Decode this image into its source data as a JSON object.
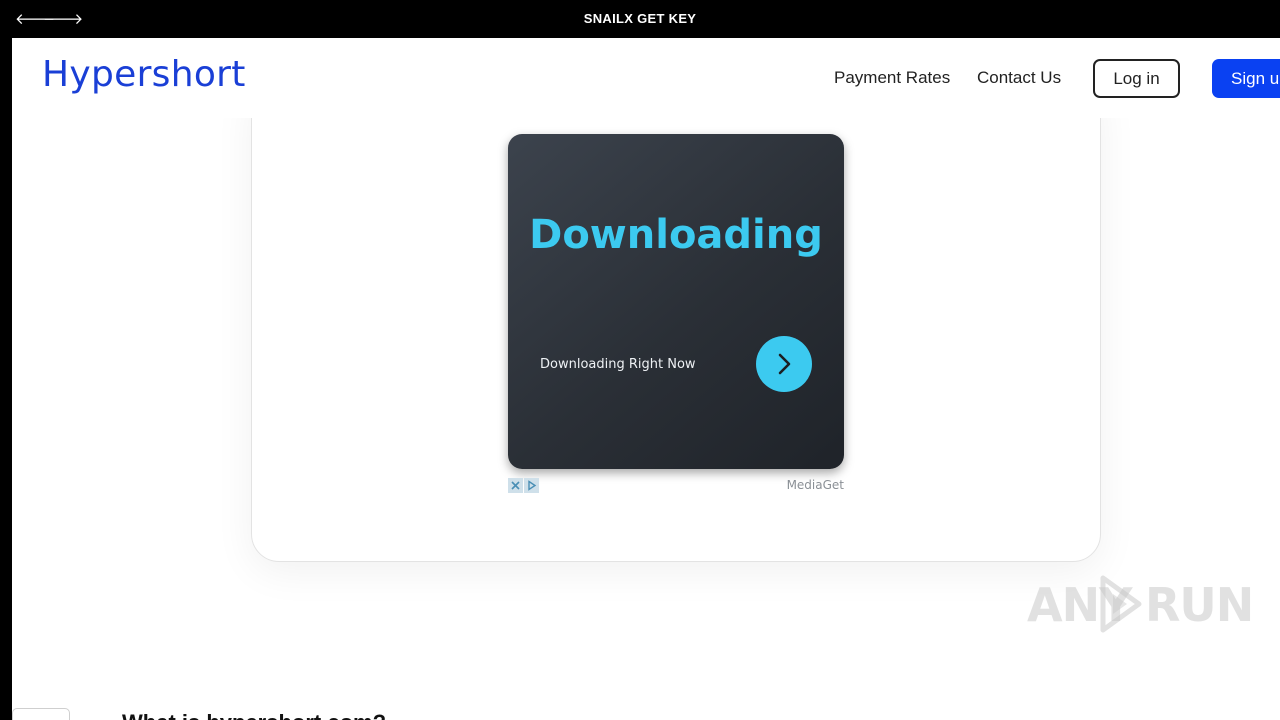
{
  "window": {
    "title": "SNAILX GET KEY",
    "back_glyph": "🡐",
    "forward_glyph": "🡒"
  },
  "header": {
    "brand": "Hypershort",
    "nav": {
      "payment_rates": "Payment Rates",
      "contact_us": "Contact Us"
    },
    "login_label": "Log in",
    "signup_label": "Sign up"
  },
  "ad": {
    "headline": "Downloading",
    "subtext": "Downloading Right Now",
    "source": "MediaGet",
    "icons": [
      "adchoices-close-icon",
      "adchoices-info-icon",
      "chevron-right-icon"
    ]
  },
  "content": {
    "faq_heading": "What is hypershort.com?"
  },
  "watermark": {
    "left": "ANY",
    "right": "RUN"
  },
  "colors": {
    "brand": "#1a3fd6",
    "signup": "#0a41f2",
    "ad_accent": "#3ccaf0",
    "ad_background": "#2f343b"
  }
}
